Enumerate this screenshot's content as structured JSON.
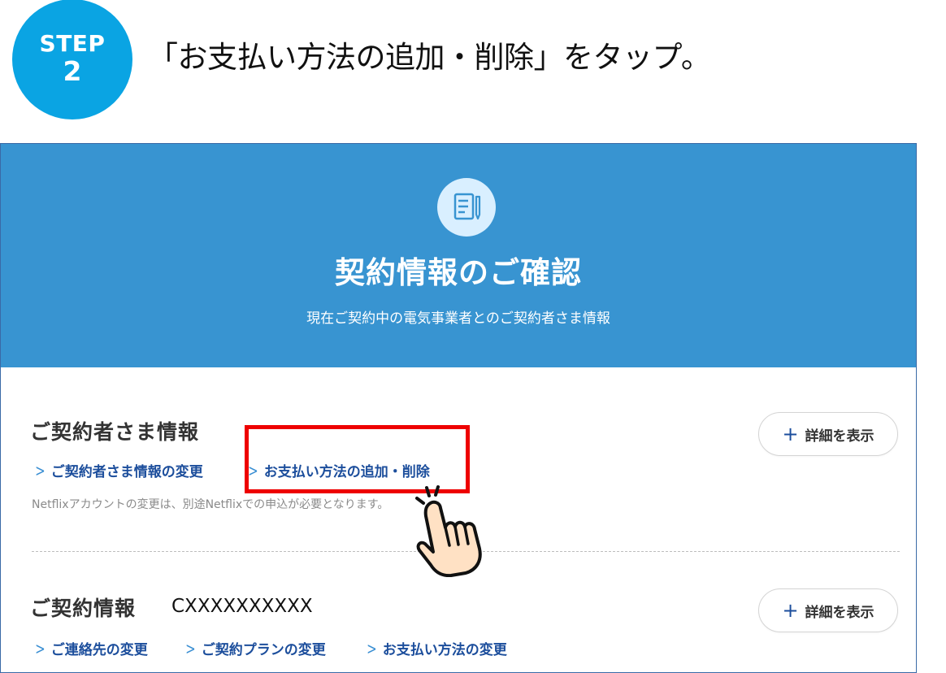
{
  "step": {
    "label": "STEP",
    "number": "2"
  },
  "instruction": "「お支払い方法の追加・削除」をタップ。",
  "hero": {
    "icon": "document-pen-icon",
    "title": "契約情報のご確認",
    "subtitle": "現在ご契約中の電気事業者とのご契約者さま情報"
  },
  "subscriber_section": {
    "title": "ご契約者さま情報",
    "links": [
      {
        "label": "ご契約者さま情報の変更"
      },
      {
        "label": "お支払い方法の追加・削除"
      }
    ],
    "note": "Netflixアカウントの変更は、別途Netflixでの申込が必要となります。",
    "details_button": "詳細を表示"
  },
  "contract_section": {
    "title": "ご契約情報",
    "contract_number": "CXXXXXXXXXX",
    "links": [
      {
        "label": "ご連絡先の変更"
      },
      {
        "label": "ご契約プランの変更"
      },
      {
        "label": "お支払い方法の変更"
      }
    ],
    "details_button": "詳細を表示"
  },
  "colors": {
    "step_circle": "#0aa4e3",
    "hero_bg": "#3894d1",
    "link": "#1c4e9c",
    "highlight": "#ee0000"
  },
  "icons": {
    "chevron": "chevron-right-icon",
    "plus": "plus-icon",
    "hand": "tap-hand-icon"
  }
}
